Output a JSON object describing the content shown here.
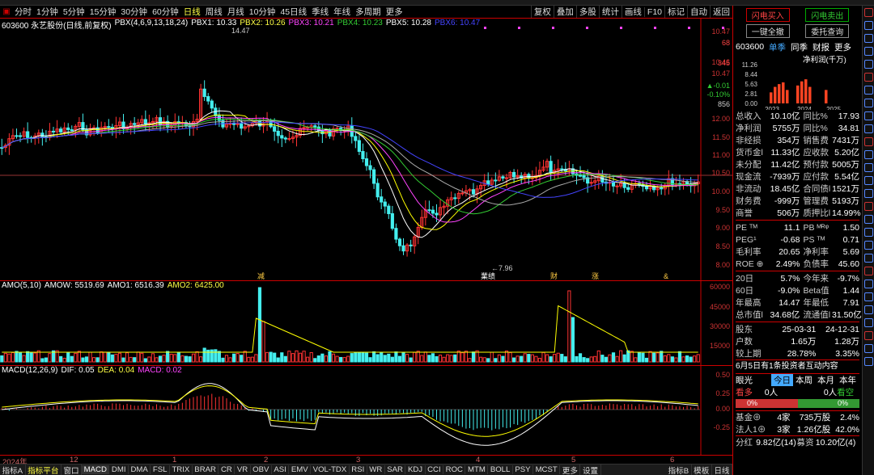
{
  "toolbar": {
    "periods": [
      "分时",
      "1分钟",
      "5分钟",
      "15分钟",
      "30分钟",
      "60分钟",
      "日线",
      "周线",
      "月线",
      "10分钟",
      "45日线",
      "季线",
      "年线",
      "多周期",
      "更多"
    ],
    "selected": "日线",
    "right_buttons": [
      "复权",
      "叠加",
      "多股",
      "统计",
      "画线",
      "F10",
      "标记",
      "自动",
      "返回"
    ]
  },
  "main_header": {
    "code_name": "603600 永艺股份(日线,前复权)",
    "indicator": "PBX(4,6,9,13,18,24)",
    "pbx1": "PBX1: 10.33",
    "pbx2": "PBX2: 10.26",
    "pbx3": "PBX3: 10.21",
    "pbx4": "PBX4: 10.23",
    "pbx5": "PBX5: 10.28",
    "pbx6": "PBX6: 10.47"
  },
  "price_axis": {
    "labels": [
      "10.47",
      "10.46",
      "10.47",
      "12.00",
      "11.50",
      "11.00",
      "10.50",
      "10.00",
      "9.50",
      "9.00",
      "8.50",
      "8.00"
    ],
    "stats": [
      "68",
      "345",
      "▲-0.01",
      "-0.10%",
      "856"
    ],
    "high_mark": "14.47",
    "low_mark": "7.96"
  },
  "markers": [
    "减",
    "業绩",
    "财",
    "涨",
    "&"
  ],
  "volume": {
    "title": "AMO(5,10)",
    "amow": "AMOW: 5519.69",
    "amo1": "AMO1: 6516.39",
    "amo2": "AMO2: 6425.00",
    "axis": [
      "60000",
      "45000",
      "30000",
      "15000"
    ]
  },
  "macd": {
    "title": "MACD(12,26,9)",
    "dif": "DIF: 0.05",
    "dea": "DEA: 0.04",
    "macd": "MACD: 0.02",
    "axis": [
      "0.50",
      "0.25",
      "0.00",
      "-0.25"
    ]
  },
  "dates": [
    "2024年",
    "12",
    "1",
    "2",
    "3",
    "4",
    "5",
    "6"
  ],
  "bottom_tabs": [
    "指标A",
    "指标平台",
    "窗口",
    "MACD",
    "DMI",
    "DMA",
    "FSL",
    "TRIX",
    "BRAR",
    "CR",
    "VR",
    "OBV",
    "ASI",
    "EMV",
    "VOL-TDX",
    "RSI",
    "WR",
    "SAR",
    "KDJ",
    "CCI",
    "ROC",
    "MTM",
    "BOLL",
    "PSY",
    "MCST",
    "更多",
    "设置"
  ],
  "bottom_right": [
    "指标B",
    "模板",
    "日线"
  ],
  "side": {
    "buttons": [
      "闪电买入",
      "闪电卖出",
      "一键全撤",
      "委托查询"
    ],
    "code": "603600",
    "tabs": [
      "单季",
      "同季",
      "财报",
      "更多"
    ],
    "fin_title": "净利润(千万)",
    "fin_axis": [
      "11.26",
      "8.44",
      "5.63",
      "2.81",
      "0.00"
    ],
    "fin_years": [
      "2023",
      "2024",
      "2025"
    ],
    "fin_values": [
      3.2,
      4.8,
      5.6,
      6.1,
      3.9,
      5.2,
      6.4,
      7.0,
      4.8,
      3.9
    ],
    "rows": [
      [
        "总收入",
        "10.10亿",
        "同比%",
        "17.93"
      ],
      [
        "净利润",
        "5755万",
        "同比%",
        "34.81"
      ],
      [
        "非经损",
        "354万",
        "销售费",
        "7431万"
      ],
      [
        "货币金l",
        "11.33亿",
        "应收款",
        "5.20亿"
      ],
      [
        "未分配",
        "11.42亿",
        "预付款",
        "5005万"
      ],
      [
        "现金流",
        "-7939万",
        "应付款",
        "5.54亿"
      ],
      [
        "非流动",
        "18.45亿",
        "合同债l",
        "1521万"
      ],
      [
        "财务费",
        "-999万",
        "管理费",
        "5193万"
      ],
      [
        "商誉",
        "506万",
        "质押比l",
        "14.99%"
      ]
    ],
    "rows2": [
      [
        "PE ᵀᴹ",
        "11.1",
        "PB ᴹᴿᵠ",
        "1.50"
      ],
      [
        "PEG¹",
        "-0.68",
        "PS ᵀᴹ",
        "0.71"
      ],
      [
        "毛利率",
        "20.65",
        "净利率",
        "5.69"
      ],
      [
        "ROE ⊕",
        "2.49%",
        "负债率",
        "45.60"
      ]
    ],
    "rows3": [
      [
        "20日",
        "5.7%",
        "今年来",
        "-9.7%"
      ],
      [
        "60日",
        "-9.0%",
        "Beta值",
        "1.44"
      ],
      [
        "年最高",
        "14.47",
        "年最低",
        "7.91"
      ],
      [
        "总市值l",
        "34.68亿",
        "流通值l",
        "31.50亿"
      ]
    ],
    "holders": {
      "label": "股东",
      "d1": "25-03-31",
      "d2": "24-12-31",
      "r1": [
        "户数",
        "1.65万",
        "1.28万"
      ],
      "r2": [
        "较上期",
        "28.78%",
        "3.35%"
      ]
    },
    "notice": "6月5日有1条投资者互动内容",
    "eye": {
      "label": "眼光",
      "tabs": [
        "今日",
        "本周",
        "本月",
        "本年"
      ],
      "bear": "看多",
      "bear_v": "0人",
      "bull_v": "0人",
      "bull": "看空",
      "pct1": "0%",
      "pct2": "0%"
    },
    "fund": [
      [
        "基金⊕",
        "4家",
        "735万股",
        "2.4%"
      ],
      [
        "法人1⊕",
        "3家",
        "1.26亿股",
        "42.0%"
      ]
    ],
    "bottom": [
      "分红",
      "9.82亿(14)",
      "募资",
      "10.20亿(4)"
    ]
  }
}
